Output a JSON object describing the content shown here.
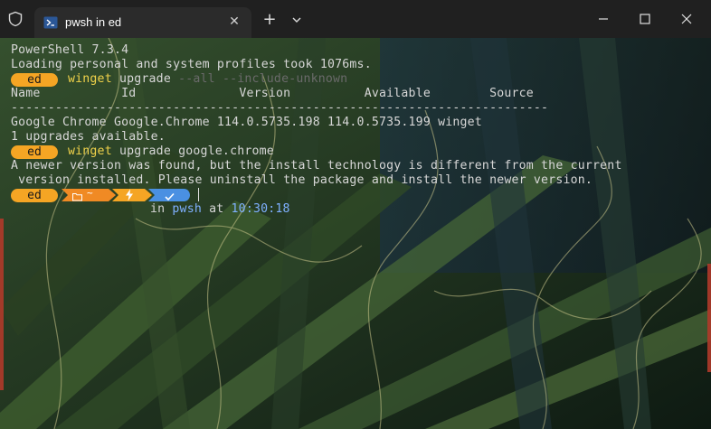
{
  "titlebar": {
    "tab_title": "pwsh in ed",
    "new_tab_label": "+",
    "close_tab_label": "✕"
  },
  "terminal": {
    "lines": {
      "version": "PowerShell 7.3.4",
      "profile": "Loading personal and system profiles took 1076ms.",
      "header": "Name           Id              Version          Available        Source",
      "divider": "-------------------------------------------------------------------------",
      "row": "Google Chrome Google.Chrome 114.0.5735.198 114.0.5735.199 winget",
      "count": "1 upgrades available.",
      "error1": "A newer version was found, but the install technology is different from the current",
      "error2": " version installed. Please uninstall the package and install the newer version."
    },
    "prompt1": {
      "user": "ed",
      "bin": "winget",
      "sub": " upgrade ",
      "flags": "--all --include-unknown"
    },
    "prompt2": {
      "user": "ed",
      "bin": "winget",
      "args": " upgrade google.chrome"
    },
    "prompt3": {
      "user": "ed",
      "folder_icon": "folder-icon",
      "home": "~",
      "bolt_icon": "bolt-icon",
      "check_icon": "check-icon"
    },
    "status": {
      "in": "in ",
      "shell": "pwsh",
      "at": " at ",
      "time": "10:30:18"
    }
  },
  "colors": {
    "accent_orange": "#f5a524",
    "segment_blue": "#4a90e2",
    "command_yellow": "#f0d24a",
    "text": "#d7d7d7"
  }
}
